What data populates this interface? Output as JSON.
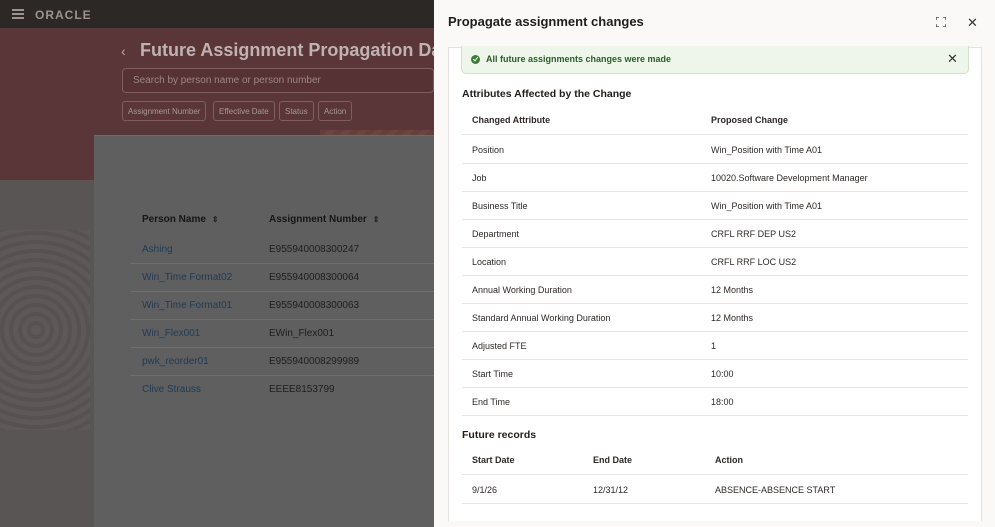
{
  "background": {
    "brand": "ORACLE",
    "page_title": "Future Assignment Propagation Dashboard",
    "search_placeholder": "Search by person name or person number",
    "filters": [
      "Assignment Number",
      "Effective Date",
      "Status",
      "Action"
    ],
    "table": {
      "columns": [
        "Person Name",
        "Assignment Number"
      ],
      "rows": [
        {
          "name": "Ashing",
          "number": "E955940008300247"
        },
        {
          "name": "Win_Time Format02",
          "number": "E955940008300064"
        },
        {
          "name": "Win_Time Format01",
          "number": "E955940008300063"
        },
        {
          "name": "Win_Flex001",
          "number": "EWin_Flex001"
        },
        {
          "name": "pwk_reorder01",
          "number": "E955940008299989"
        },
        {
          "name": "Clive Strauss",
          "number": "EEEE8153799"
        }
      ]
    }
  },
  "drawer": {
    "title": "Propagate assignment changes",
    "banner": "All future assignments changes were made",
    "attributes_section": {
      "title": "Attributes Affected by the Change",
      "columns": [
        "Changed Attribute",
        "Proposed Change"
      ],
      "rows": [
        {
          "attribute": "Position",
          "change": "Win_Position with Time A01"
        },
        {
          "attribute": "Job",
          "change": "10020.Software Development Manager"
        },
        {
          "attribute": "Business Title",
          "change": "Win_Position with Time A01"
        },
        {
          "attribute": "Department",
          "change": "CRFL RRF DEP US2"
        },
        {
          "attribute": "Location",
          "change": "CRFL RRF LOC US2"
        },
        {
          "attribute": "Annual Working Duration",
          "change": "12 Months"
        },
        {
          "attribute": "Standard Annual Working Duration",
          "change": "12 Months"
        },
        {
          "attribute": "Adjusted FTE",
          "change": "1"
        },
        {
          "attribute": "Start Time",
          "change": "10:00"
        },
        {
          "attribute": "End Time",
          "change": "18:00"
        }
      ]
    },
    "future_section": {
      "title": "Future records",
      "columns": [
        "Start Date",
        "End Date",
        "Action"
      ],
      "rows": [
        {
          "start": "9/1/26",
          "end": "12/31/12",
          "action": "ABSENCE-ABSENCE START"
        }
      ]
    }
  },
  "colors": {
    "hero": "#5b3638",
    "drawer_bg": "#fbf9f8",
    "success_bg": "#eef6ec",
    "success_icon": "#3e7a3a",
    "link": "#1f3a55"
  },
  "icons": [
    "hamburger-icon",
    "chevron-left-icon",
    "sort-icon",
    "check-circle-icon",
    "close-icon",
    "expand-icon"
  ]
}
